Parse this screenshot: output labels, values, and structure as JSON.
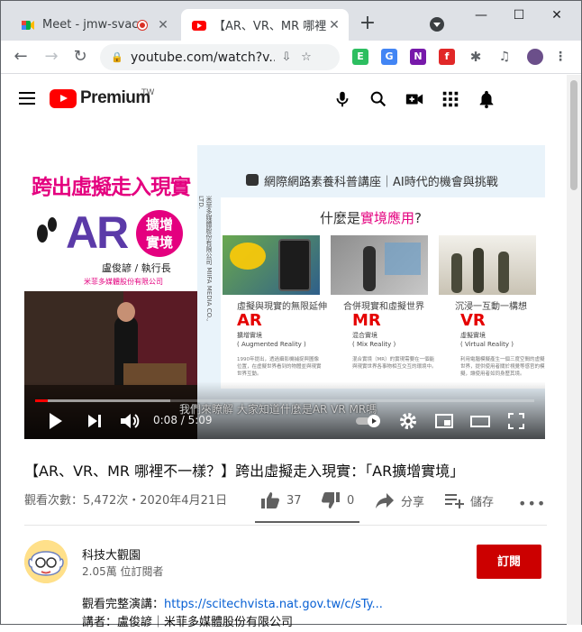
{
  "browser": {
    "tabs": [
      {
        "title": "Meet - jmw-svac-",
        "recording": true
      },
      {
        "title": "【AR、VR、MR 哪裡不",
        "active": true
      }
    ],
    "new_tab_label": "+",
    "url": "youtube.com/watch?v...",
    "window_controls": {
      "minimize": "—",
      "maximize": "☐",
      "close": "✕"
    },
    "extensions": [
      {
        "name": "evernote-icon",
        "color": "#2dbe60"
      },
      {
        "name": "translate-icon",
        "color": "#4285f4"
      },
      {
        "name": "onenote-icon",
        "color": "#7719aa"
      },
      {
        "name": "flipboard-icon",
        "color": "#e12828"
      },
      {
        "name": "puzzle-icon",
        "color": "#5f6368"
      },
      {
        "name": "media-icon",
        "color": "#5f6368"
      }
    ]
  },
  "youtube": {
    "brand": "Premium",
    "region": "TW",
    "header_icons": [
      "mic-icon",
      "search-icon",
      "create-video-icon",
      "apps-icon",
      "notifications-icon"
    ]
  },
  "video_frame": {
    "left_title": "跨出虛擬走入現實",
    "ar_word": "AR",
    "badge_line1": "擴增",
    "badge_line2": "實境",
    "speaker": "盧俊諺 / 執行長",
    "company": "米菲多媒體股份有限公司",
    "vertical_text": "米菲多媒體股份有限公司 MIIFA MEDIA CO., LTD.",
    "heading": "網際網路素養科普講座｜AI時代的機會與挑戰",
    "question_before": "什麼是",
    "question_highlight": "實境應用",
    "question_after": "?",
    "columns": [
      {
        "caption": "虛擬與現實的無限延伸",
        "code": "AR",
        "sub1": "擴增實境",
        "sub2": "( Augmented Reality )",
        "para": "1990年提出，透過攝影機捕捉與圖像位置，在虛擬世界看到的物體並與現實世界互動。"
      },
      {
        "caption": "合併現實和虛擬世界",
        "code": "MR",
        "sub1": "混合實境",
        "sub2": "( Mix Reality )",
        "para": "混合實境（MR）的實現需要在一個能與現實世界各事物相互交互的環境中。"
      },
      {
        "caption": "沉浸一互動一構想",
        "code": "VR",
        "sub1": "虛擬實境",
        "sub2": "( Virtual Reality )",
        "para": "利用電腦模擬產生一個三度空間的虛擬世界，提供使用者關於視覺等感官的模擬，讓使用者如同身歷其境。"
      }
    ],
    "subtitle": "我們來瞭解 大家知道什麼是AR VR MR嗎"
  },
  "player": {
    "current_time": "0:08",
    "duration": "5:09",
    "time_display": "0:08 / 5:09",
    "played_fraction": 0.026,
    "loaded_fraction": 0.27,
    "controls": [
      "play-icon",
      "next-icon",
      "volume-icon",
      "autoplay-toggle",
      "settings-icon",
      "miniplayer-icon",
      "theater-icon",
      "fullscreen-icon"
    ]
  },
  "video_info": {
    "title": "【AR、VR、MR 哪裡不一樣？】跨出虛擬走入現實：「AR擴增實境」",
    "meta": "觀看次數：5,472次・2020年4月21日",
    "likes": "37",
    "dislikes": "0",
    "share_label": "分享",
    "save_label": "儲存",
    "like_ratio": 1.0
  },
  "channel": {
    "name": "科技大觀園",
    "subscribers": "2.05萬 位訂閱者",
    "subscribe_label": "訂閱"
  },
  "description": {
    "line1_prefix": "觀看完整演講：",
    "line1_link": "https://scitechvista.nat.gov.tw/c/sTy...",
    "line2": "講者：盧俊諺｜米菲多媒體股份有限公司"
  }
}
